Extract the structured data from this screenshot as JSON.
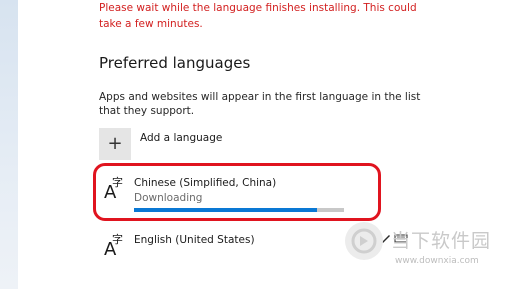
{
  "warning_text": "Please wait while the language finishes installing. This could take a few minutes.",
  "preferred_languages": {
    "title": "Preferred languages",
    "description": "Apps and websites will appear in the first language in the list that they support.",
    "add_icon": "+",
    "add_label": "Add a language",
    "languages": [
      {
        "name": "Chinese (Simplified, China)",
        "status": "Downloading",
        "progress": 0.87,
        "icon": "language-icon"
      },
      {
        "name": "English (United States)",
        "icon": "language-icon"
      }
    ]
  },
  "icon_glyphs": {
    "big_a": "A",
    "zi": "字"
  },
  "colors": {
    "warning": "#d21f1f",
    "progress_fill": "#0a78d4",
    "progress_track": "#c8c8c8",
    "highlight": "#e0141f"
  },
  "watermark": {
    "title": "当下软件园",
    "url": "www.downxia.com"
  }
}
